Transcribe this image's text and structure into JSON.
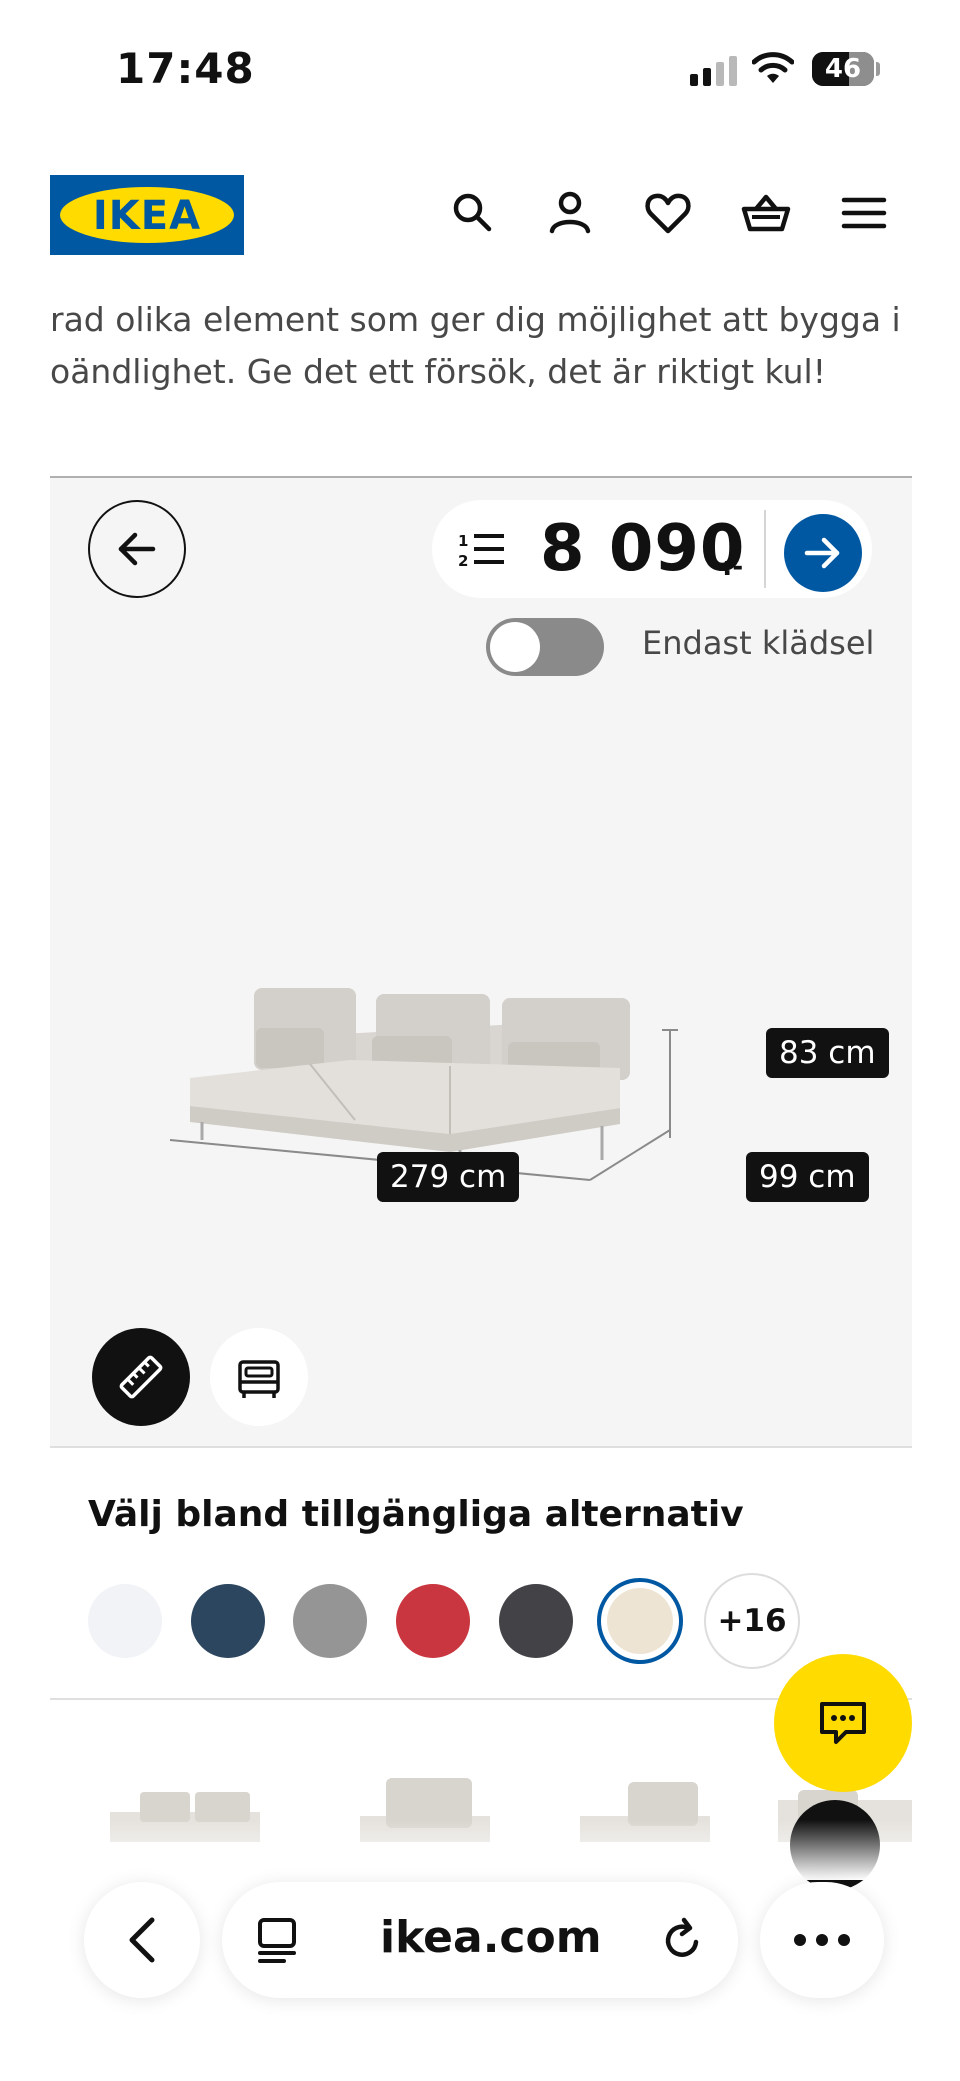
{
  "status_bar": {
    "time": "17:48",
    "battery": "46"
  },
  "header": {
    "logo_text": "IKEA",
    "icons": [
      "search-icon",
      "account-icon",
      "heart-icon",
      "basket-icon",
      "menu-icon"
    ]
  },
  "intro": {
    "line1": "rad olika element som ger dig möjlighet att bygga i",
    "line2": "oändlighet. Ge det ett försök, det är riktigt kul!"
  },
  "viewer": {
    "price": "8 090",
    "price_suffix": ":-",
    "toggle_label": "Endast klädsel",
    "toggle_on": false,
    "dimensions": {
      "height": "83 cm",
      "width": "279 cm",
      "depth": "99 cm"
    }
  },
  "options": {
    "title": "Välj bland tillgängliga alternativ",
    "swatches": [
      {
        "color": "#f1f3f7",
        "selected": false
      },
      {
        "color": "#2c465f",
        "selected": false
      },
      {
        "color": "#959595",
        "selected": false
      },
      {
        "color": "#c9363f",
        "selected": false
      },
      {
        "color": "#434347",
        "selected": false
      },
      {
        "color": "#eee4d4",
        "selected": true
      }
    ],
    "more_label": "+16"
  },
  "browser_bar": {
    "url": "ikea.com"
  },
  "colors": {
    "ikea_blue": "#0058a3",
    "ikea_yellow": "#ffdb00"
  }
}
